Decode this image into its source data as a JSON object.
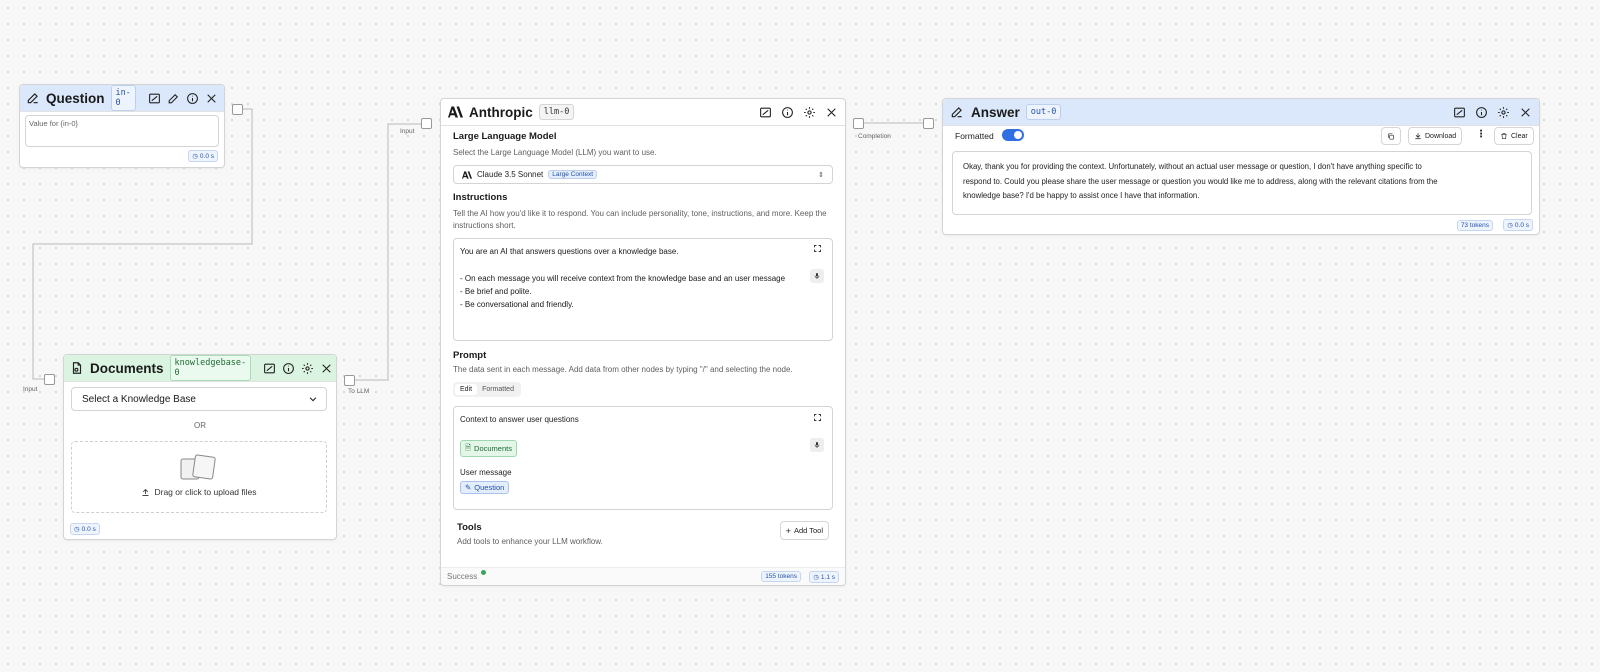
{
  "question": {
    "title": "Question",
    "tag": "in-0",
    "placeholder": "Value for {in-0}",
    "time": "0.0 s"
  },
  "documents": {
    "title": "Documents",
    "tag": "knowledgebase-0",
    "select_placeholder": "Select a Knowledge Base",
    "or_label": "OR",
    "upload_label": "Drag or click to upload files",
    "time": "0.0 s",
    "input_label": "Input",
    "output_label": "To LLM"
  },
  "anthropic": {
    "title": "Anthropic",
    "tag": "llm-0",
    "input_label": "Input",
    "output_label": "Completion",
    "llm_section_title": "Large Language Model",
    "llm_section_desc": "Select the Large Language Model (LLM) you want to use.",
    "model_name": "Claude 3.5 Sonnet",
    "model_badge": "Large Context",
    "instructions_title": "Instructions",
    "instructions_desc": "Tell the AI how you'd like it to respond. You can include personality, tone, instructions, and more. Keep the instructions short.",
    "instructions_lines": [
      "You are an AI that answers questions over a knowledge base.",
      "",
      "- On each message you will receive context from the knowledge base and an user message",
      "- Be brief and polite.",
      "- Be conversational and friendly."
    ],
    "prompt_title": "Prompt",
    "prompt_desc": "The data sent in each message. Add data from other nodes by typing \"/\" and selecting the node.",
    "prompt_tabs": [
      "Edit",
      "Formatted"
    ],
    "prompt_context_label": "Context to answer user questions",
    "prompt_chip_documents": "Documents",
    "prompt_user_label": "User message",
    "prompt_chip_question": "Question",
    "tools_title": "Tools",
    "tools_desc": "Add tools to enhance your LLM workflow.",
    "add_tool_label": "Add Tool",
    "status": "Success",
    "tokens": "155 tokens",
    "time": "1.1 s"
  },
  "answer": {
    "title": "Answer",
    "tag": "out-0",
    "formatted_label": "Formatted",
    "formatted_on": true,
    "download_label": "Download",
    "clear_label": "Clear",
    "text_lines": [
      "Okay, thank you for providing the context. Unfortunately, without an actual user message or question, I don't have anything specific to",
      "respond to. Could you please share the user message or question you would like me to address, along with the relevant citations from the",
      "knowledge base? I'd be happy to assist once I have that information."
    ],
    "tokens": "73 tokens",
    "time": "0.0 s"
  },
  "colors": {
    "accent": "#2f6fe4",
    "header_blue": "#dbe8fb",
    "header_green": "#dbf3e1",
    "status_green": "#3aa55d"
  }
}
